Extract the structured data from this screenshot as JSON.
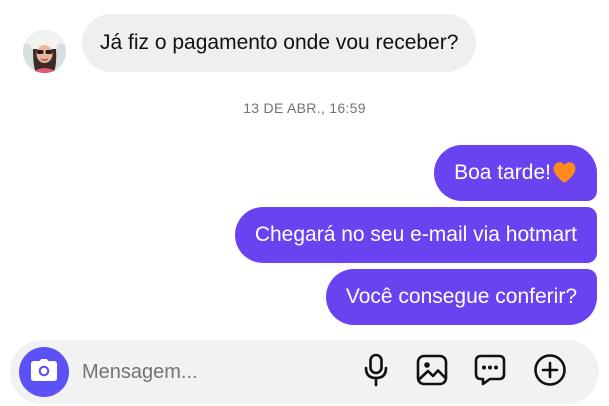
{
  "conversation": {
    "incoming": [
      {
        "text": "Já fiz o pagamento onde vou receber?"
      }
    ],
    "timestamp": "13 DE ABR., 16:59",
    "outgoing": [
      {
        "text": "Boa tarde!",
        "emoji": "orange-heart"
      },
      {
        "text": "Chegará no seu e-mail via hotmart"
      },
      {
        "text": "Você consegue conferir?"
      }
    ]
  },
  "composer": {
    "placeholder": "Mensagem...",
    "icons": [
      "camera-icon",
      "microphone-icon",
      "gallery-icon",
      "sticker-icon",
      "add-icon"
    ]
  },
  "colors": {
    "outgoing_bubble": "#6a43f0",
    "incoming_bubble": "#efefef",
    "camera_button": "#5b51f4",
    "heart": "#ff8c1a"
  }
}
